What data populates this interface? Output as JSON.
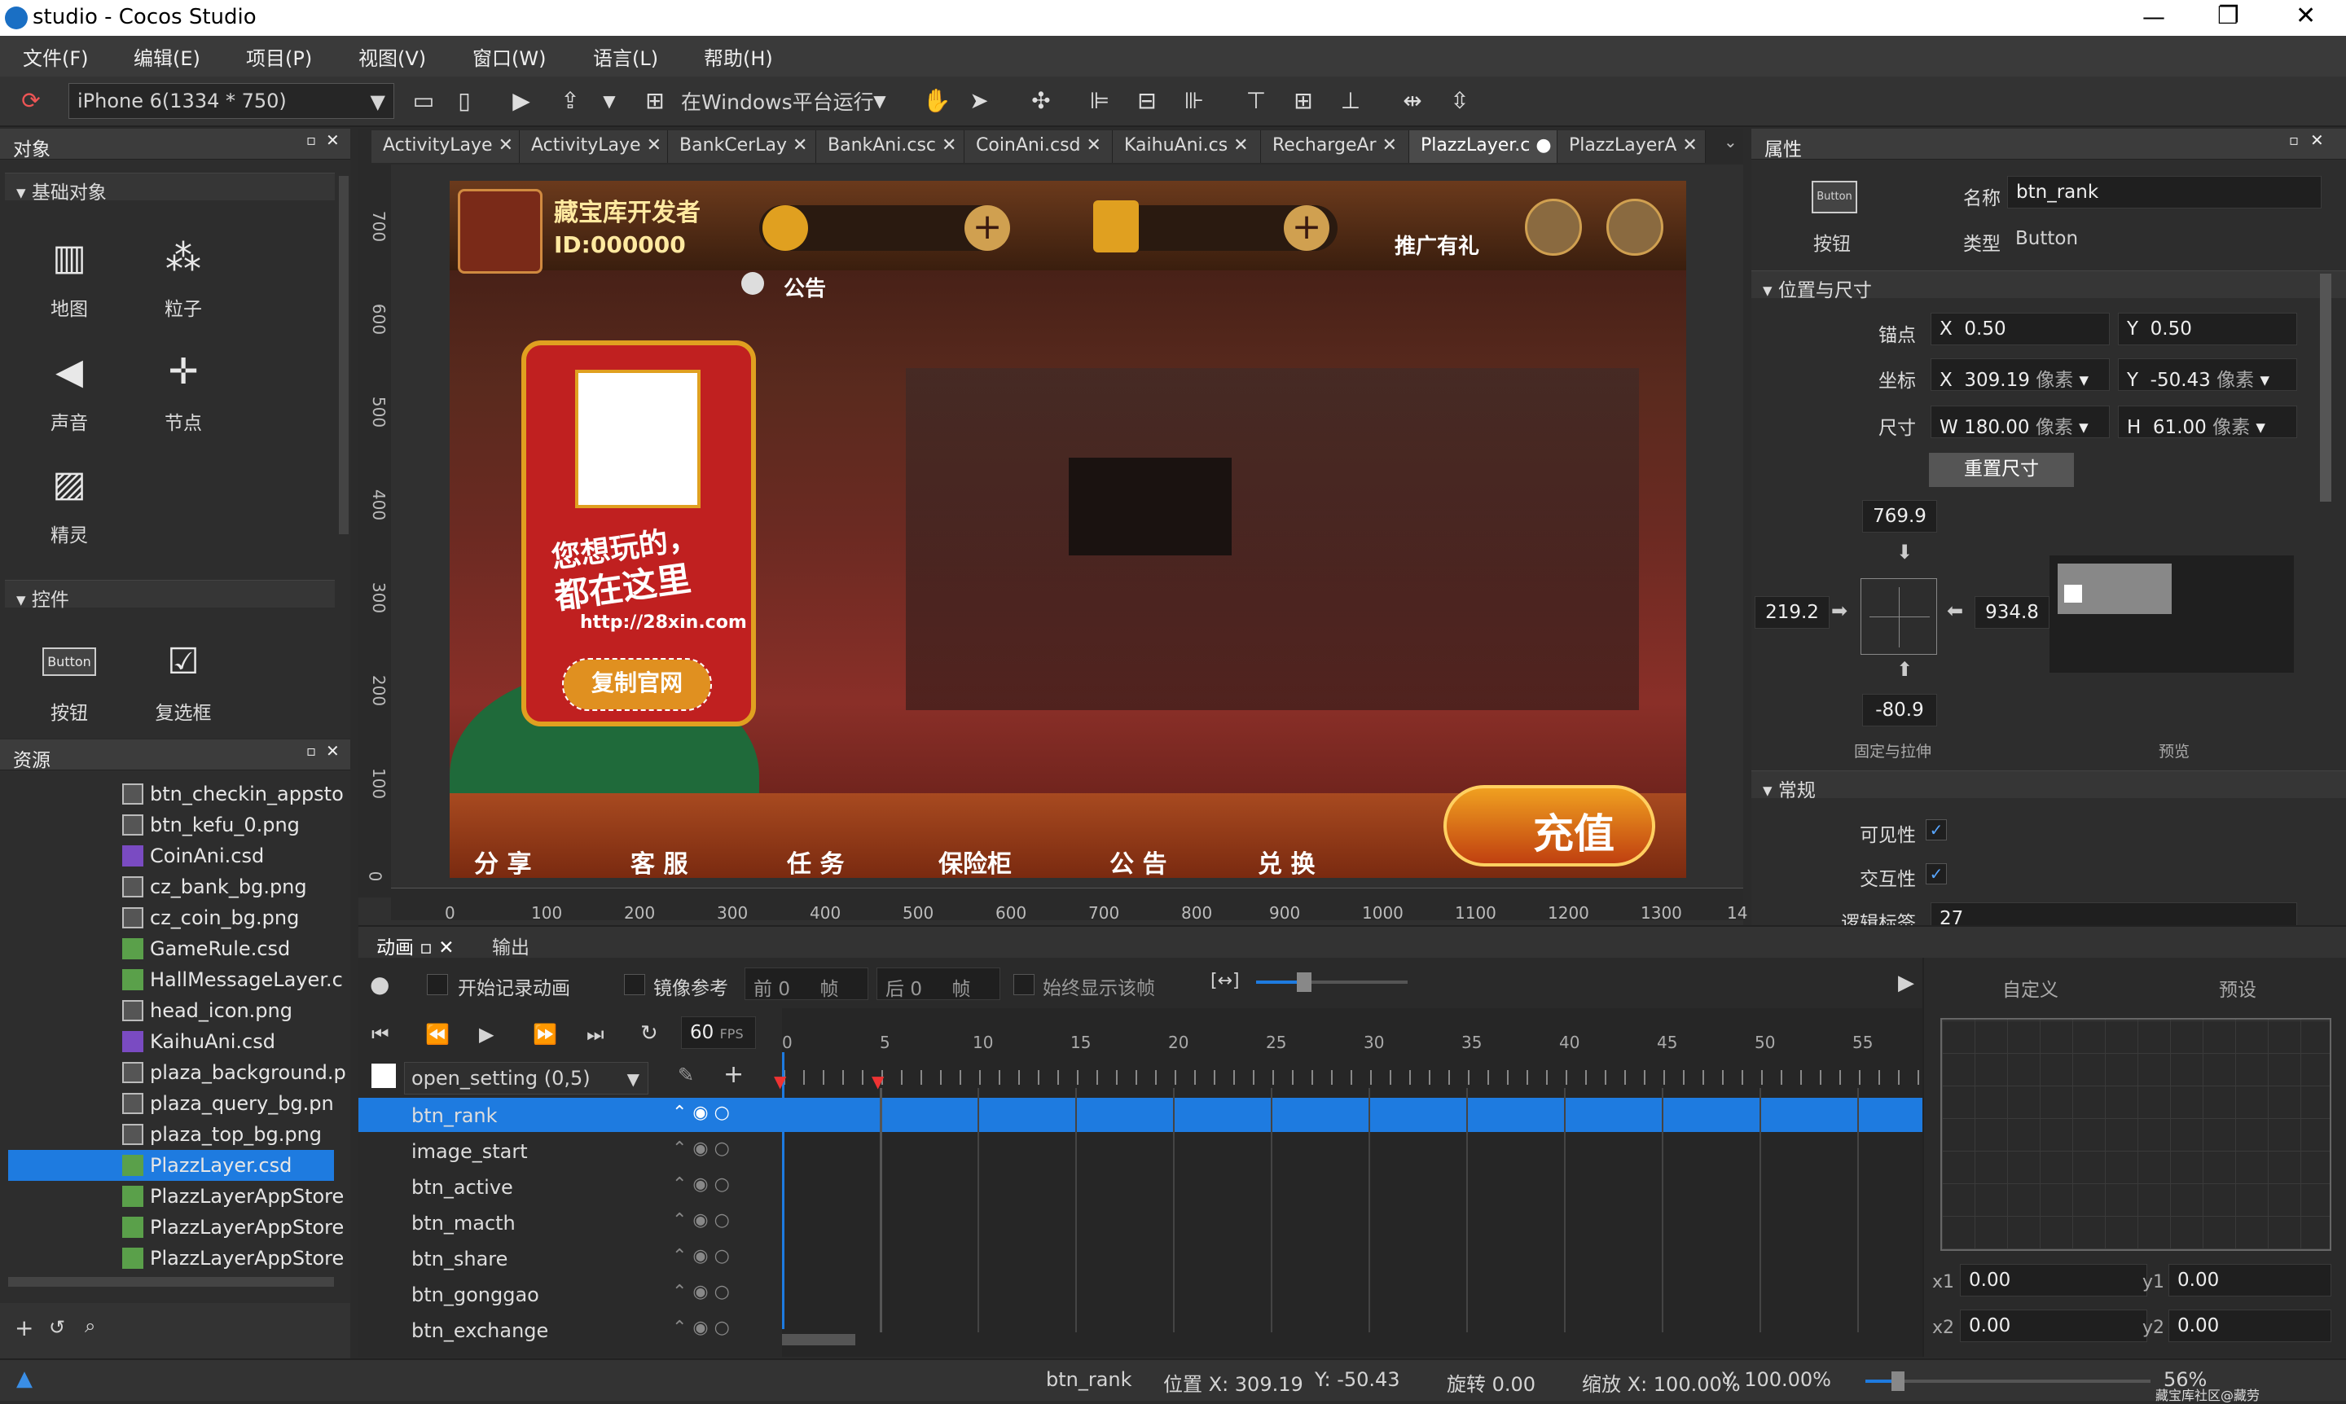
{
  "window": {
    "title": "studio - Cocos Studio",
    "minimize": "—",
    "maximize": "❐",
    "close": "✕"
  },
  "menu": [
    "文件(F)",
    "编辑(E)",
    "项目(P)",
    "视图(V)",
    "窗口(W)",
    "语言(L)",
    "帮助(H)"
  ],
  "toolbar": {
    "device": "iPhone 6(1334 * 750)",
    "run": "在Windows平台运行"
  },
  "objects_panel": {
    "title": "对象",
    "basic_section": "基础对象",
    "basic": [
      "地图",
      "粒子",
      "声音",
      "节点",
      "精灵"
    ],
    "controls_section": "控件",
    "controls": [
      "按钮",
      "复选框"
    ]
  },
  "resources_panel": {
    "title": "资源",
    "files": [
      "btn_checkin_appsto",
      "btn_kefu_0.png",
      "CoinAni.csd",
      "cz_bank_bg.png",
      "cz_coin_bg.png",
      "GameRule.csd",
      "HallMessageLayer.c",
      "head_icon.png",
      "KaihuAni.csd",
      "plaza_background.p",
      "plaza_query_bg.pn",
      "plaza_top_bg.png",
      "PlazzLayer.csd",
      "PlazzLayerAppStore",
      "PlazzLayerAppStore",
      "PlazzLayerAppStore"
    ],
    "selected": "PlazzLayer.csd"
  },
  "tabs": [
    "ActivityLaye",
    "ActivityLaye",
    "BankCerLay",
    "BankAni.csc",
    "CoinAni.csd",
    "KaihuAni.cs",
    "RechargeAr",
    "PlazzLayer.c",
    "PlazzLayerA"
  ],
  "active_tab": "PlazzLayer.c",
  "ruler": {
    "x": [
      "0",
      "100",
      "200",
      "300",
      "400",
      "500",
      "600",
      "700",
      "800",
      "900",
      "1000",
      "1100",
      "1200",
      "1300",
      "14"
    ],
    "y": [
      "700",
      "600",
      "500",
      "400",
      "300",
      "200",
      "100",
      "0"
    ]
  },
  "game": {
    "username": "藏宝库开发者",
    "id": "ID:000000",
    "notice": "公告",
    "promo": "推广有礼",
    "ad_line1": "您想玩的，",
    "ad_line2": "都在这里",
    "ad_url": "http://28xin.com",
    "copy_btn": "复制官网",
    "bottom": [
      "分 享",
      "客 服",
      "任 务",
      "保险柜",
      "公 告",
      "兑 换"
    ],
    "recharge": "充值"
  },
  "properties": {
    "title": "属性",
    "widget_icon": "Button",
    "widget_label": "按钮",
    "name_label": "名称",
    "name_value": "btn_rank",
    "type_label": "类型",
    "type_value": "Button",
    "pos_section": "位置与尺寸",
    "anchor_label": "锚点",
    "anchor_x": "0.50",
    "anchor_y": "0.50",
    "pos_label": "坐标",
    "pos_x": "309.19",
    "pos_y": "-50.43",
    "unit": "像素",
    "size_label": "尺寸",
    "size_w": "180.00",
    "size_h": "61.00",
    "reset_btn": "重置尺寸",
    "top_margin": "769.9",
    "left_margin": "219.2",
    "right_margin": "934.8",
    "bottom_margin": "-80.9",
    "fix_label": "固定与拉伸",
    "preview_label": "预览",
    "general_section": "常规",
    "visible_label": "可见性",
    "interact_label": "交互性",
    "tag_label": "逻辑标签",
    "tag_value": "27"
  },
  "animation": {
    "tab": "动画",
    "output_tab": "输出",
    "record": "开始记录动画",
    "mirror": "镜像参考",
    "before": "前",
    "before_val": "0",
    "frame": "帧",
    "after": "后",
    "after_val": "0",
    "always_show": "始终显示该帧",
    "fps": "60",
    "fps_label": "FPS",
    "anim_name": "open_setting (0,5)",
    "timeline_ticks": [
      "0",
      "5",
      "10",
      "15",
      "20",
      "25",
      "30",
      "35",
      "40",
      "45",
      "50",
      "55"
    ],
    "nodes": [
      "btn_rank",
      "image_start",
      "btn_active",
      "btn_macth",
      "btn_share",
      "btn_gonggao",
      "btn_exchange"
    ],
    "selected_node": "btn_rank",
    "curve_custom": "自定义",
    "curve_preset": "预设",
    "x1": "0.00",
    "y1": "0.00",
    "x2": "0.00",
    "y2": "0.00"
  },
  "status": {
    "node": "btn_rank",
    "position": "位置 X: 309.19",
    "pos_y": "Y: -50.43",
    "rotation": "旋转 0.00",
    "scale_x": "缩放 X: 100.00%",
    "scale_y": "Y: 100.00%",
    "zoom": "56%",
    "watermark": "藏宝库社区@藏劳"
  },
  "colors": {
    "accent": "#1e7be0",
    "selection": "#1565c0"
  }
}
